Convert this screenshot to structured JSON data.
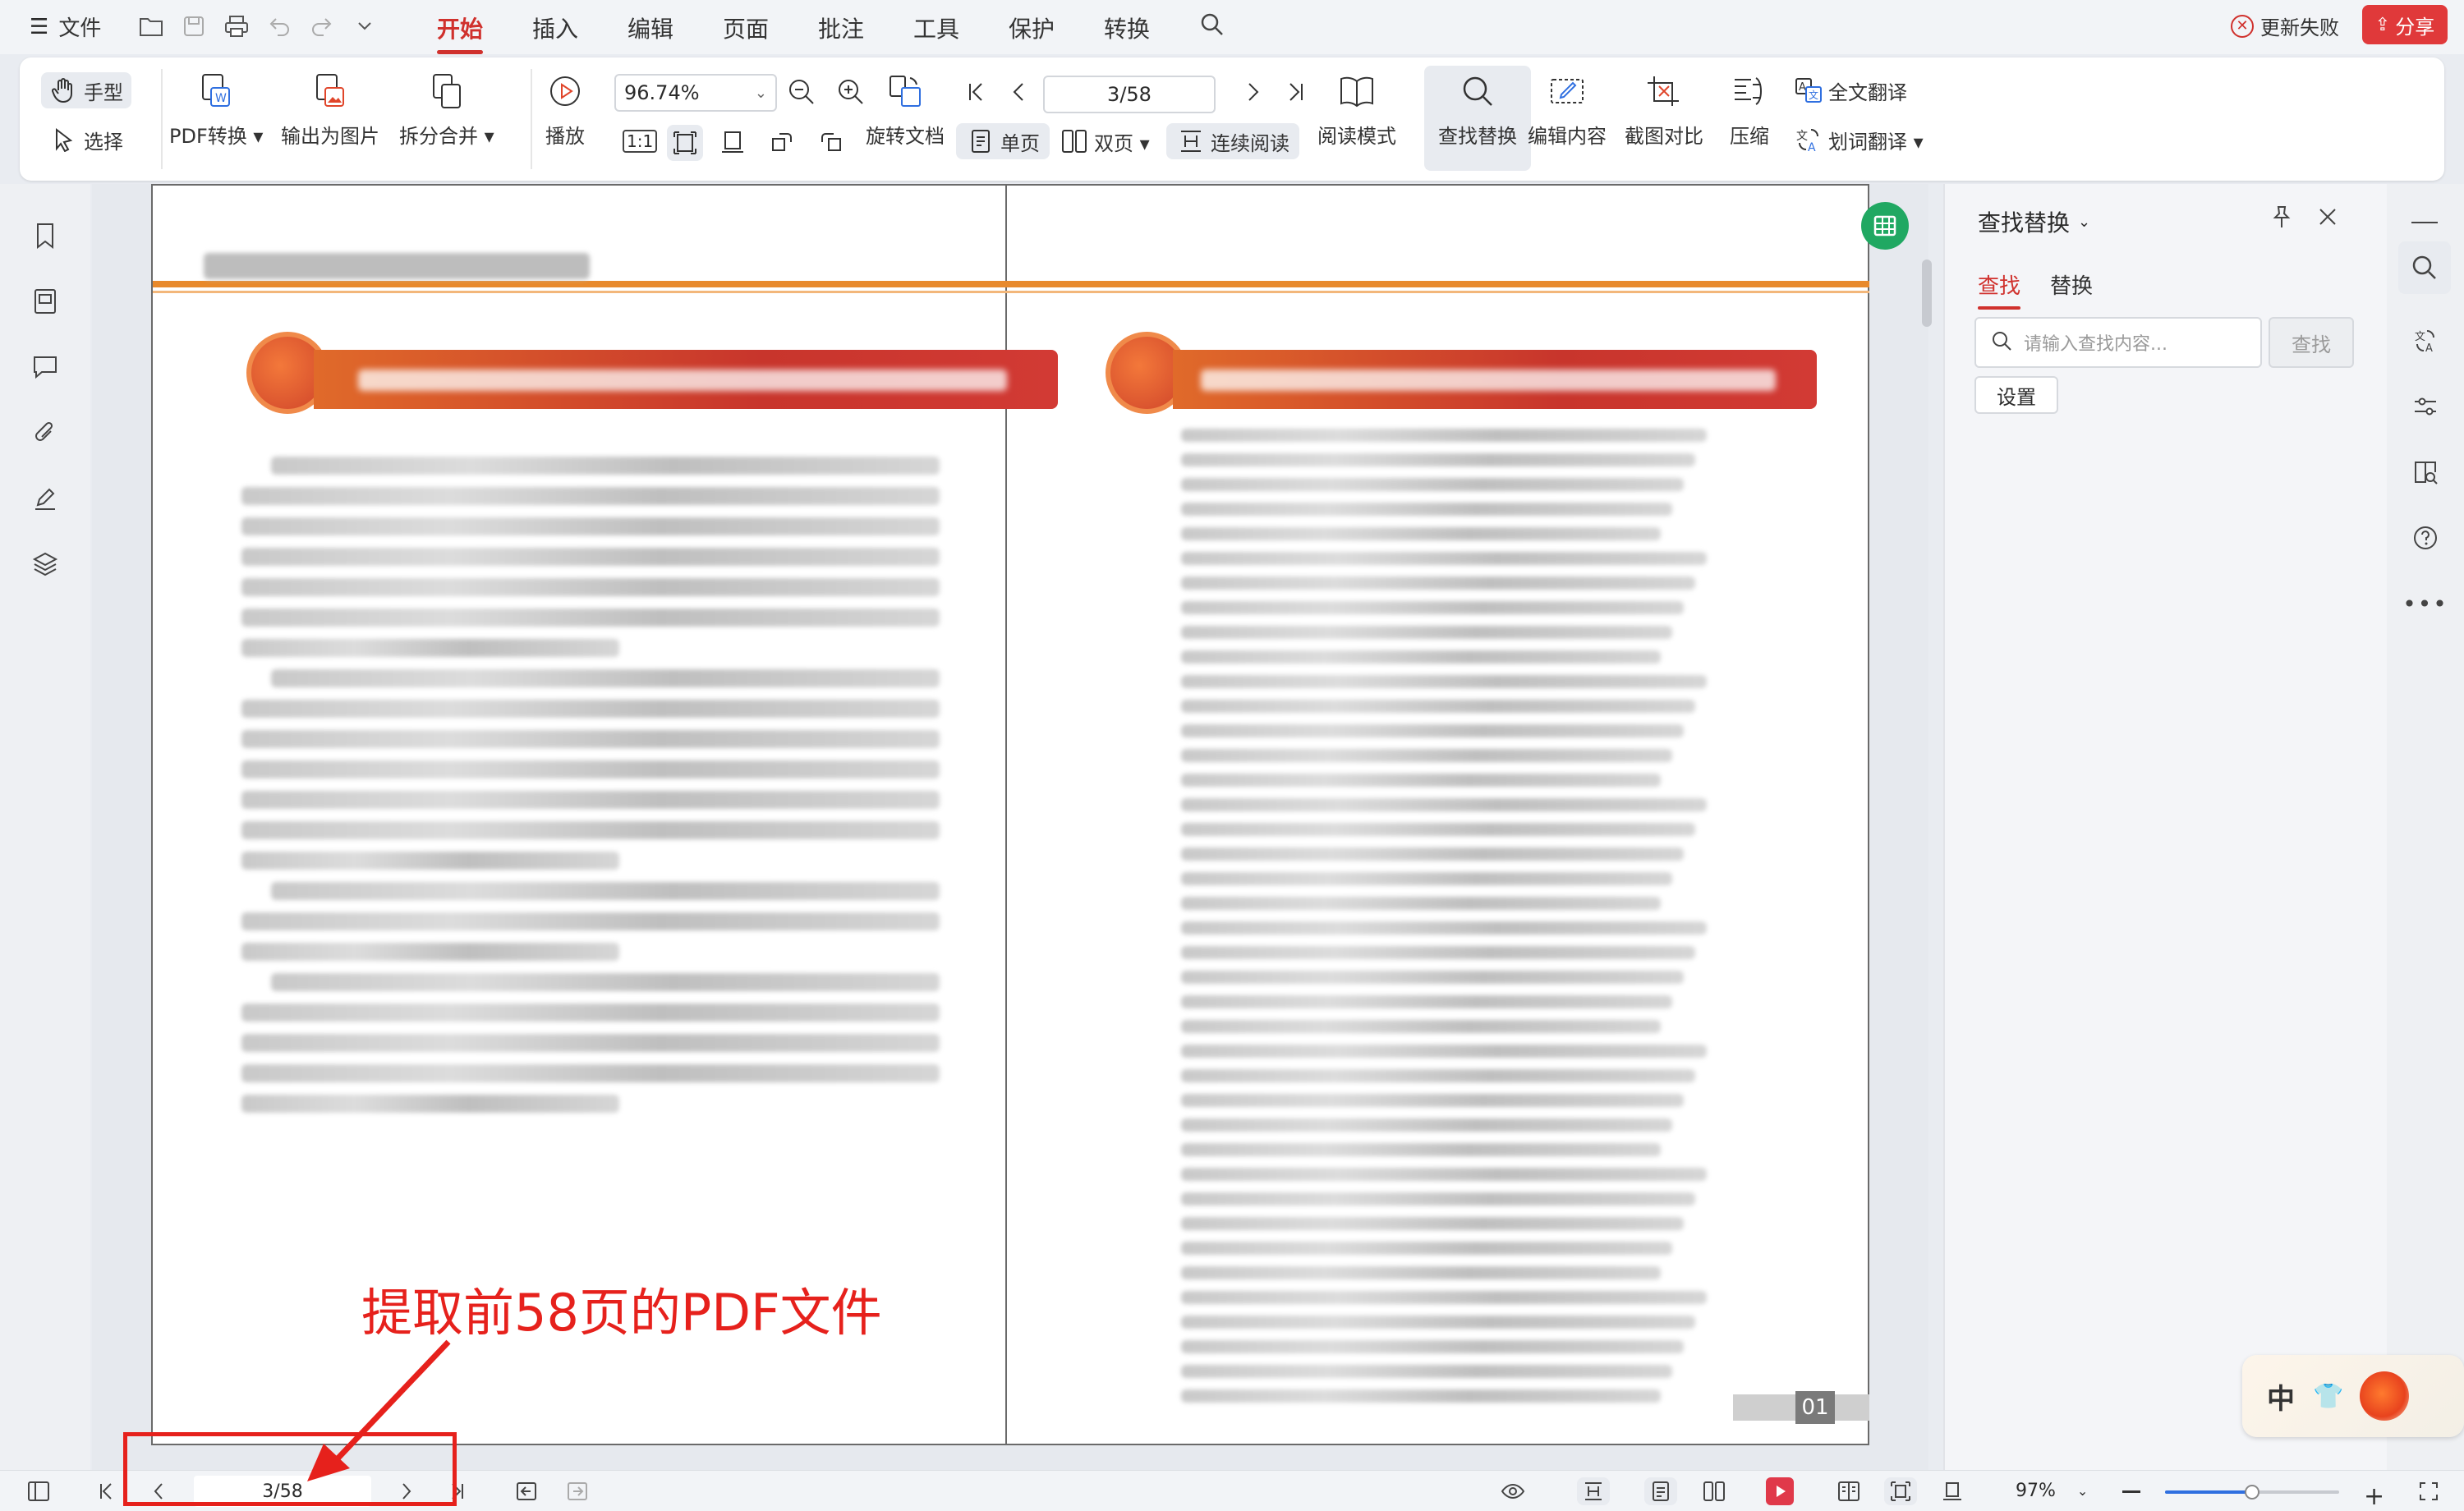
{
  "menubar": {
    "file_label": "文件",
    "tabs": [
      "开始",
      "插入",
      "编辑",
      "页面",
      "批注",
      "工具",
      "保护",
      "转换"
    ],
    "active_tab_index": 0,
    "update_status": "更新失败",
    "share_label": "分享",
    "accent_color": "#d0312d"
  },
  "ribbon": {
    "hand_tool": "手型",
    "select_tool": "选择",
    "pdf_convert": "PDF转换",
    "export_image": "输出为图片",
    "split_merge": "拆分合并",
    "play": "播放",
    "zoom_value": "96.74%",
    "actual_size": "1:1",
    "rotate_doc": "旋转文档",
    "single_page": "单页",
    "double_page": "双页",
    "page_field": "3/58",
    "continuous_read": "连续阅读",
    "read_mode": "阅读模式",
    "find_replace": "查找替换",
    "edit_content": "编辑内容",
    "screenshot_compare": "截图对比",
    "compress": "压缩",
    "full_translate": "全文翻译",
    "word_translate": "划词翻译"
  },
  "document": {
    "page_number_badge": "01"
  },
  "find_panel": {
    "title": "查找替换",
    "tab_find": "查找",
    "tab_replace": "替换",
    "search_placeholder": "请输入查找内容...",
    "search_button": "查找",
    "settings_button": "设置"
  },
  "statusbar": {
    "page_field": "3/58",
    "zoom_value": "97%",
    "zoom_level_fraction": 0.5
  },
  "annotation": {
    "text": "提取前58页的PDF文件",
    "color": "#e6211c"
  },
  "ime": {
    "label": "中"
  }
}
